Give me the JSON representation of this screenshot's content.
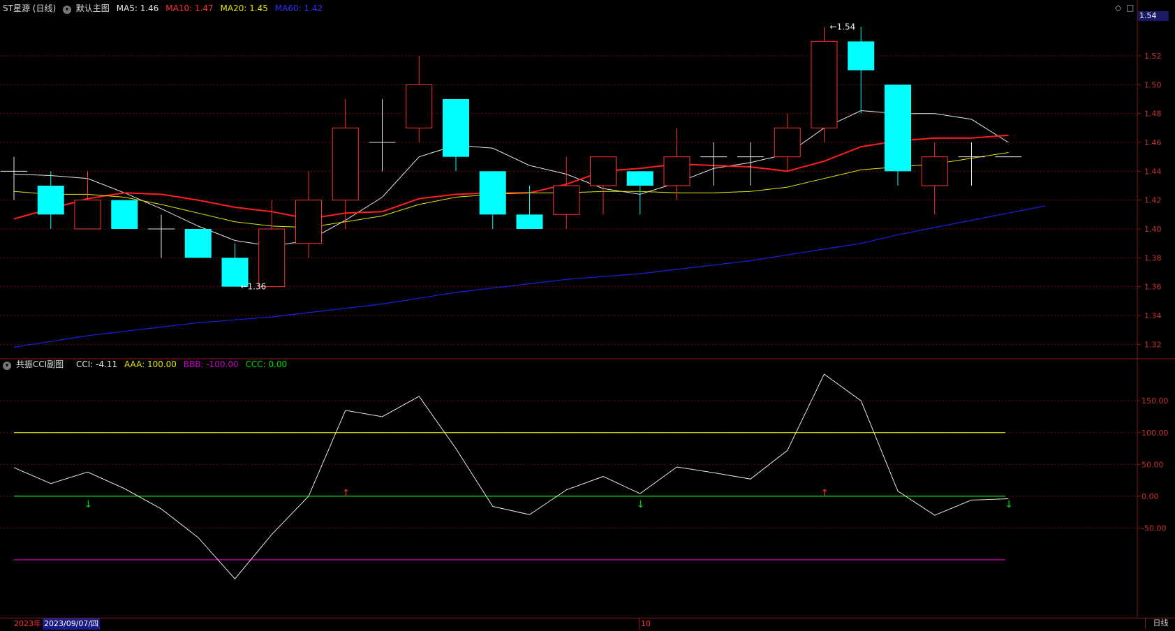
{
  "main_header": {
    "stock_name": "ST星源 (日线)",
    "main_indicator_name": "默认主图",
    "ma5_label": "MA5: 1.46",
    "ma10_label": "MA10: 1.47",
    "ma20_label": "MA20: 1.45",
    "ma60_label": "MA60: 1.42"
  },
  "sub_header": {
    "indicator_name": "共振CCI副图",
    "cci_label": "CCI: -4.11",
    "aaa_label": "AAA: 100.00",
    "bbb_label": "BBB: -100.00",
    "ccc_label": "CCC: 0.00"
  },
  "colors": {
    "up": "#ff3333",
    "down": "#00ffff",
    "doji": "#e8e8e8",
    "ma5": "#e8e8e8",
    "ma10": "#ff2020",
    "ma20": "#e6e600",
    "ma60": "#2020e0",
    "grid": "#7a0a0a",
    "aaa": "#e6e600",
    "bbb": "#cc00cc",
    "ccc": "#00dd00",
    "cci": "#e8e8e8"
  },
  "current_price_tag": "1.54",
  "bottom_bar": {
    "year_label": "2023年",
    "cursor_date": "2023/09/07/四",
    "month_label": "10",
    "period_button": "日线"
  },
  "chart_data": [
    {
      "type": "candlestick",
      "ylim": [
        1.31,
        1.55
      ],
      "y_ticks": [
        "1.32",
        "1.34",
        "1.36",
        "1.38",
        "1.40",
        "1.42",
        "1.44",
        "1.46",
        "1.48",
        "1.50",
        "1.52"
      ],
      "candles": [
        {
          "o": 1.44,
          "h": 1.45,
          "l": 1.42,
          "c": 1.44
        },
        {
          "o": 1.43,
          "h": 1.44,
          "l": 1.4,
          "c": 1.41
        },
        {
          "o": 1.4,
          "h": 1.44,
          "l": 1.4,
          "c": 1.42
        },
        {
          "o": 1.42,
          "h": 1.42,
          "l": 1.4,
          "c": 1.4
        },
        {
          "o": 1.4,
          "h": 1.41,
          "l": 1.38,
          "c": 1.4
        },
        {
          "o": 1.4,
          "h": 1.4,
          "l": 1.38,
          "c": 1.38
        },
        {
          "o": 1.38,
          "h": 1.39,
          "l": 1.36,
          "c": 1.36
        },
        {
          "o": 1.36,
          "h": 1.42,
          "l": 1.36,
          "c": 1.4
        },
        {
          "o": 1.39,
          "h": 1.44,
          "l": 1.38,
          "c": 1.42
        },
        {
          "o": 1.42,
          "h": 1.49,
          "l": 1.4,
          "c": 1.47
        },
        {
          "o": 1.46,
          "h": 1.49,
          "l": 1.44,
          "c": 1.46
        },
        {
          "o": 1.47,
          "h": 1.52,
          "l": 1.46,
          "c": 1.5
        },
        {
          "o": 1.49,
          "h": 1.49,
          "l": 1.44,
          "c": 1.45
        },
        {
          "o": 1.44,
          "h": 1.44,
          "l": 1.4,
          "c": 1.41
        },
        {
          "o": 1.41,
          "h": 1.43,
          "l": 1.4,
          "c": 1.4
        },
        {
          "o": 1.41,
          "h": 1.45,
          "l": 1.4,
          "c": 1.43
        },
        {
          "o": 1.43,
          "h": 1.45,
          "l": 1.41,
          "c": 1.45
        },
        {
          "o": 1.44,
          "h": 1.44,
          "l": 1.41,
          "c": 1.43
        },
        {
          "o": 1.43,
          "h": 1.47,
          "l": 1.42,
          "c": 1.45
        },
        {
          "o": 1.45,
          "h": 1.46,
          "l": 1.43,
          "c": 1.45
        },
        {
          "o": 1.45,
          "h": 1.46,
          "l": 1.43,
          "c": 1.45
        },
        {
          "o": 1.45,
          "h": 1.48,
          "l": 1.44,
          "c": 1.47
        },
        {
          "o": 1.47,
          "h": 1.54,
          "l": 1.46,
          "c": 1.53
        },
        {
          "o": 1.53,
          "h": 1.54,
          "l": 1.48,
          "c": 1.51
        },
        {
          "o": 1.5,
          "h": 1.5,
          "l": 1.43,
          "c": 1.44
        },
        {
          "o": 1.43,
          "h": 1.46,
          "l": 1.41,
          "c": 1.45
        },
        {
          "o": 1.45,
          "h": 1.46,
          "l": 1.43,
          "c": 1.45
        },
        {
          "o": 1.45,
          "h": 1.45,
          "l": 1.45,
          "c": 1.45
        }
      ],
      "series": [
        {
          "name": "MA5",
          "values": [
            1.438,
            1.437,
            1.435,
            1.425,
            1.414,
            1.402,
            1.392,
            1.388,
            1.392,
            1.406,
            1.422,
            1.45,
            1.458,
            1.456,
            1.444,
            1.438,
            1.428,
            1.424,
            1.432,
            1.442,
            1.446,
            1.452,
            1.47,
            1.482,
            1.48,
            1.48,
            1.476,
            1.46
          ]
        },
        {
          "name": "MA10",
          "values": [
            1.407,
            1.414,
            1.421,
            1.425,
            1.424,
            1.42,
            1.415,
            1.412,
            1.407,
            1.411,
            1.412,
            1.421,
            1.424,
            1.425,
            1.425,
            1.431,
            1.44,
            1.442,
            1.445,
            1.444,
            1.443,
            1.44,
            1.447,
            1.457,
            1.461,
            1.463,
            1.463,
            1.465
          ]
        },
        {
          "name": "MA20",
          "values": [
            1.426,
            1.424,
            1.424,
            1.422,
            1.417,
            1.411,
            1.405,
            1.402,
            1.401,
            1.405,
            1.409,
            1.417,
            1.422,
            1.424,
            1.425,
            1.425,
            1.426,
            1.426,
            1.425,
            1.425,
            1.426,
            1.429,
            1.435,
            1.441,
            1.443,
            1.445,
            1.449,
            1.453
          ]
        },
        {
          "name": "MA60",
          "values": [
            1.318,
            1.322,
            1.326,
            1.329,
            1.332,
            1.335,
            1.337,
            1.339,
            1.342,
            1.345,
            1.348,
            1.352,
            1.356,
            1.359,
            1.362,
            1.365,
            1.367,
            1.369,
            1.372,
            1.375,
            1.378,
            1.382,
            1.386,
            1.39,
            1.396,
            1.401,
            1.406,
            1.411,
            1.416
          ]
        }
      ],
      "annotations": [
        {
          "text": "1.54",
          "index": 22,
          "value": 1.54
        },
        {
          "text": "1.36",
          "index": 6,
          "value": 1.36
        }
      ]
    },
    {
      "type": "line",
      "ylim": [
        -190,
        215
      ],
      "y_ticks": [
        "150.00",
        "100.00",
        "50.00",
        "0.00",
        "-50.00"
      ],
      "reference_lines": [
        {
          "name": "AAA",
          "value": 100
        },
        {
          "name": "BBB",
          "value": -100
        },
        {
          "name": "CCC",
          "value": 0
        }
      ],
      "series": [
        {
          "name": "CCI",
          "values": [
            45,
            20,
            38,
            12,
            -20,
            -65,
            -130,
            -60,
            0,
            135,
            125,
            157,
            75,
            -16,
            -29,
            10,
            31,
            4,
            46,
            37,
            27,
            72,
            192,
            150,
            8,
            -30,
            -6,
            -4
          ]
        }
      ],
      "signals": [
        {
          "index": 2,
          "direction": "down"
        },
        {
          "index": 9,
          "direction": "up"
        },
        {
          "index": 17,
          "direction": "down"
        },
        {
          "index": 22,
          "direction": "up"
        },
        {
          "index": 27,
          "direction": "down"
        }
      ]
    }
  ]
}
